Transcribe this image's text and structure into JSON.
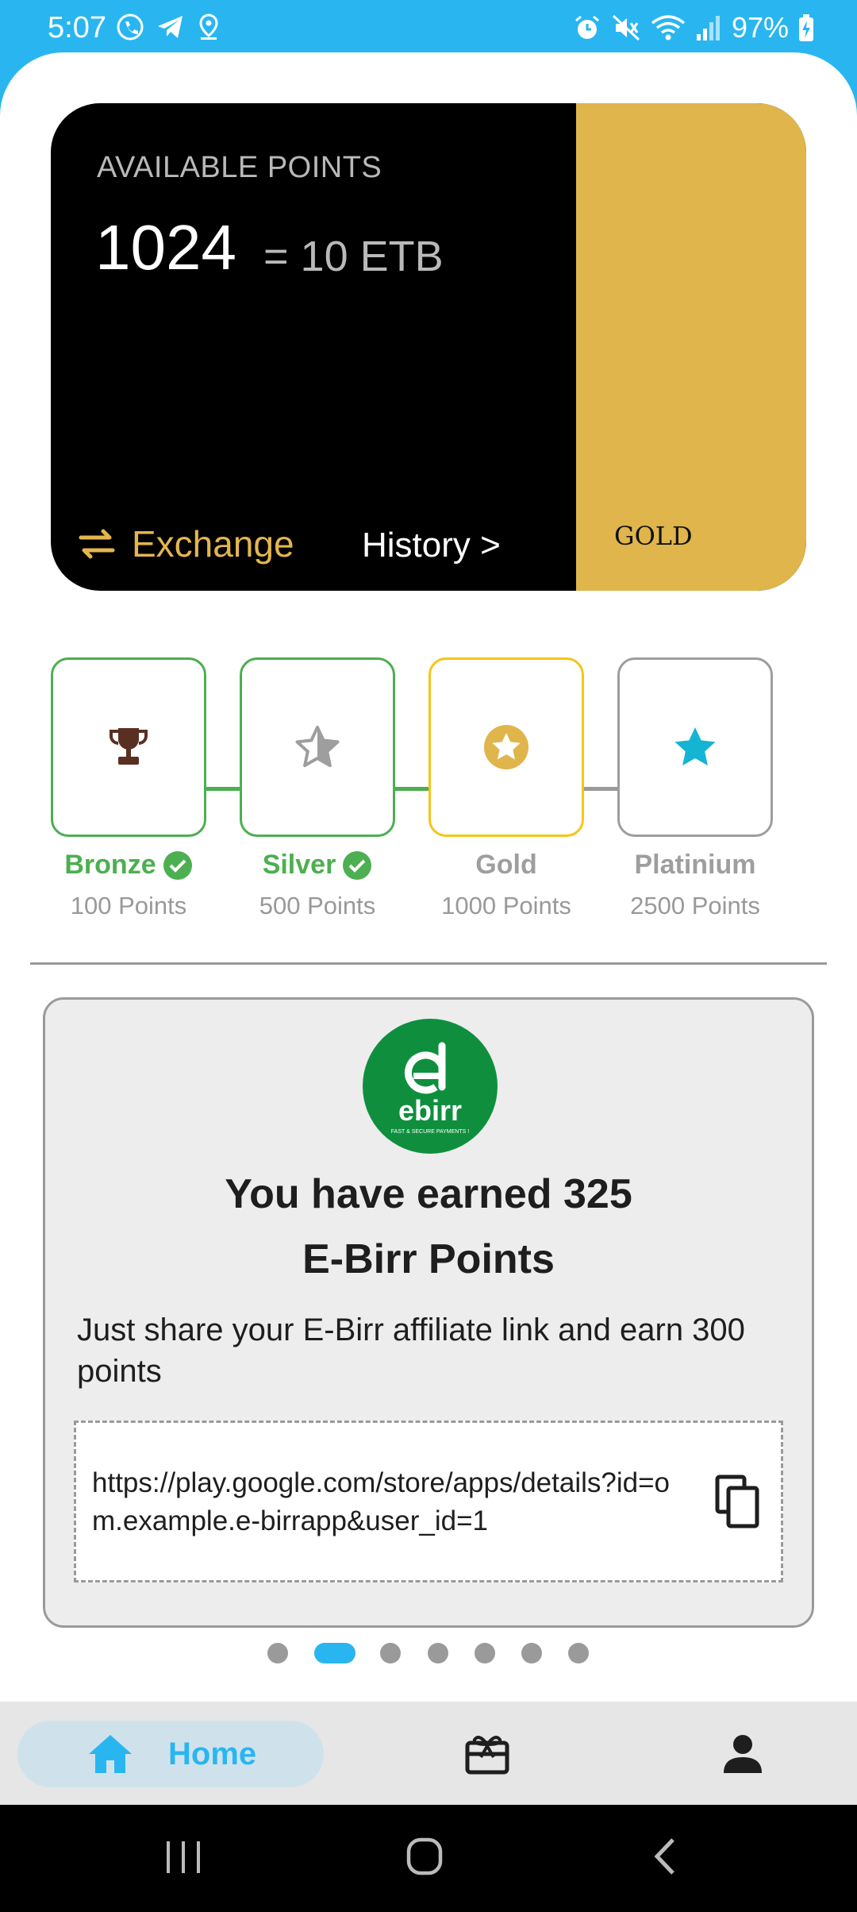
{
  "status_bar": {
    "time": "5:07",
    "battery": "97%"
  },
  "points_card": {
    "caption": "AVAILABLE POINTS",
    "points": "1024",
    "equivalent": "= 10 ETB",
    "exchange_label": "Exchange",
    "history_label": "History >",
    "tier": "GOLD"
  },
  "tiers": [
    {
      "name": "Bronze",
      "points": "100 Points",
      "achieved": true
    },
    {
      "name": "Silver",
      "points": "500 Points",
      "achieved": true
    },
    {
      "name": "Gold",
      "points": "1000 Points",
      "achieved": false
    },
    {
      "name": "Platinium",
      "points": "2500 Points",
      "achieved": false
    }
  ],
  "promo": {
    "logo_text": "ebirr",
    "logo_tagline": "FAST & SECURE PAYMENTS !",
    "title_line1": "You have earned 325",
    "title_line2": "E-Birr Points",
    "description": "Just share your E-Birr affiliate link and earn 300 points",
    "link": "https://play.google.com/store/apps/details?id=om.example.e-birrapp&user_id=1"
  },
  "pager": {
    "count": 7,
    "active_index": 1
  },
  "bottom_nav": {
    "home_label": "Home"
  },
  "colors": {
    "accent": "#29b6f0",
    "gold": "#dfb54c",
    "achieved_green": "#4caf50",
    "bronze": "#5a2f22",
    "platinum": "#14b4d4"
  }
}
